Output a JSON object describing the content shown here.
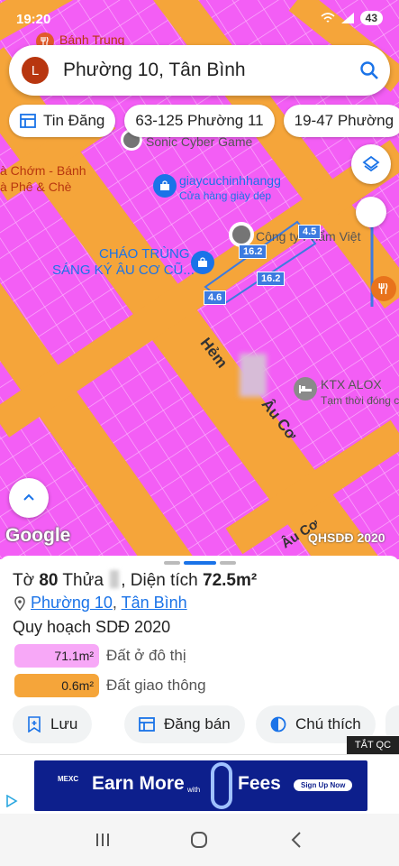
{
  "status_bar": {
    "time": "19:20",
    "battery": "43"
  },
  "search": {
    "avatar_letter": "L",
    "query": "Phường 10, Tân Bình",
    "icon": "search-icon"
  },
  "chips": [
    {
      "label": "Tin Đăng",
      "icon": "listing-icon"
    },
    {
      "label": "63-125 Phường 11"
    },
    {
      "label": "19-47 Phường"
    }
  ],
  "map": {
    "labels": {
      "banh_trung": "Bánh Trung",
      "sonic": "Sonic Cyber Game",
      "cha_chom_1": "à Chớm - Bánh",
      "cha_chom_2": "à Phê & Chè",
      "giay_name": "giaycuchinhhangg",
      "giay_sub": "Cửa hàng giày dép",
      "congty": "Công ty Phẩm Việt",
      "chao_1": "CHÁO TRÙNG",
      "chao_2": "SÁNG KÝ ÂU CƠ CŨ...",
      "ktx_name": "KTX ALOX",
      "ktx_sub": "Tạm thời đóng c",
      "street_1": "Hẻm",
      "street_2": "Âu Cơ",
      "street_3": "Âu Cơ",
      "google": "Google",
      "qhsdd": "QHSDĐ 2020"
    },
    "dimensions": {
      "d1": "4.5",
      "d2": "16.2",
      "d3": "16.2",
      "d4": "4.6"
    },
    "colors": {
      "residential": "#f35ef5",
      "traffic": "#f5a53a"
    }
  },
  "sheet": {
    "title_prefix": "Tờ ",
    "to_number": "80",
    "thua_label": " Thửa ",
    "area_label": ", Diện tích ",
    "area_value": "72.5m²",
    "ward": "Phường 10",
    "separator": ", ",
    "district": "Tân Bình",
    "plan_title": "Quy hoạch SDĐ 2020",
    "legend": [
      {
        "value": "71.1m²",
        "label": "Đất ở đô thị",
        "color": "#f7a8f7"
      },
      {
        "value": "0.6m²",
        "label": "Đất giao thông",
        "color": "#f5a53a"
      }
    ],
    "actions": [
      {
        "label": "Lưu",
        "icon": "add-bookmark-icon"
      },
      {
        "label": "Đăng bán",
        "icon": "newspaper-icon"
      },
      {
        "label": "Chú thích",
        "icon": "contrast-icon"
      }
    ]
  },
  "ad": {
    "close_label": "TẮT QC",
    "brand": "MEXC",
    "headline_1": "Earn More",
    "headline_small": "with",
    "headline_2": "Fees",
    "cta": "Sign Up Now"
  }
}
